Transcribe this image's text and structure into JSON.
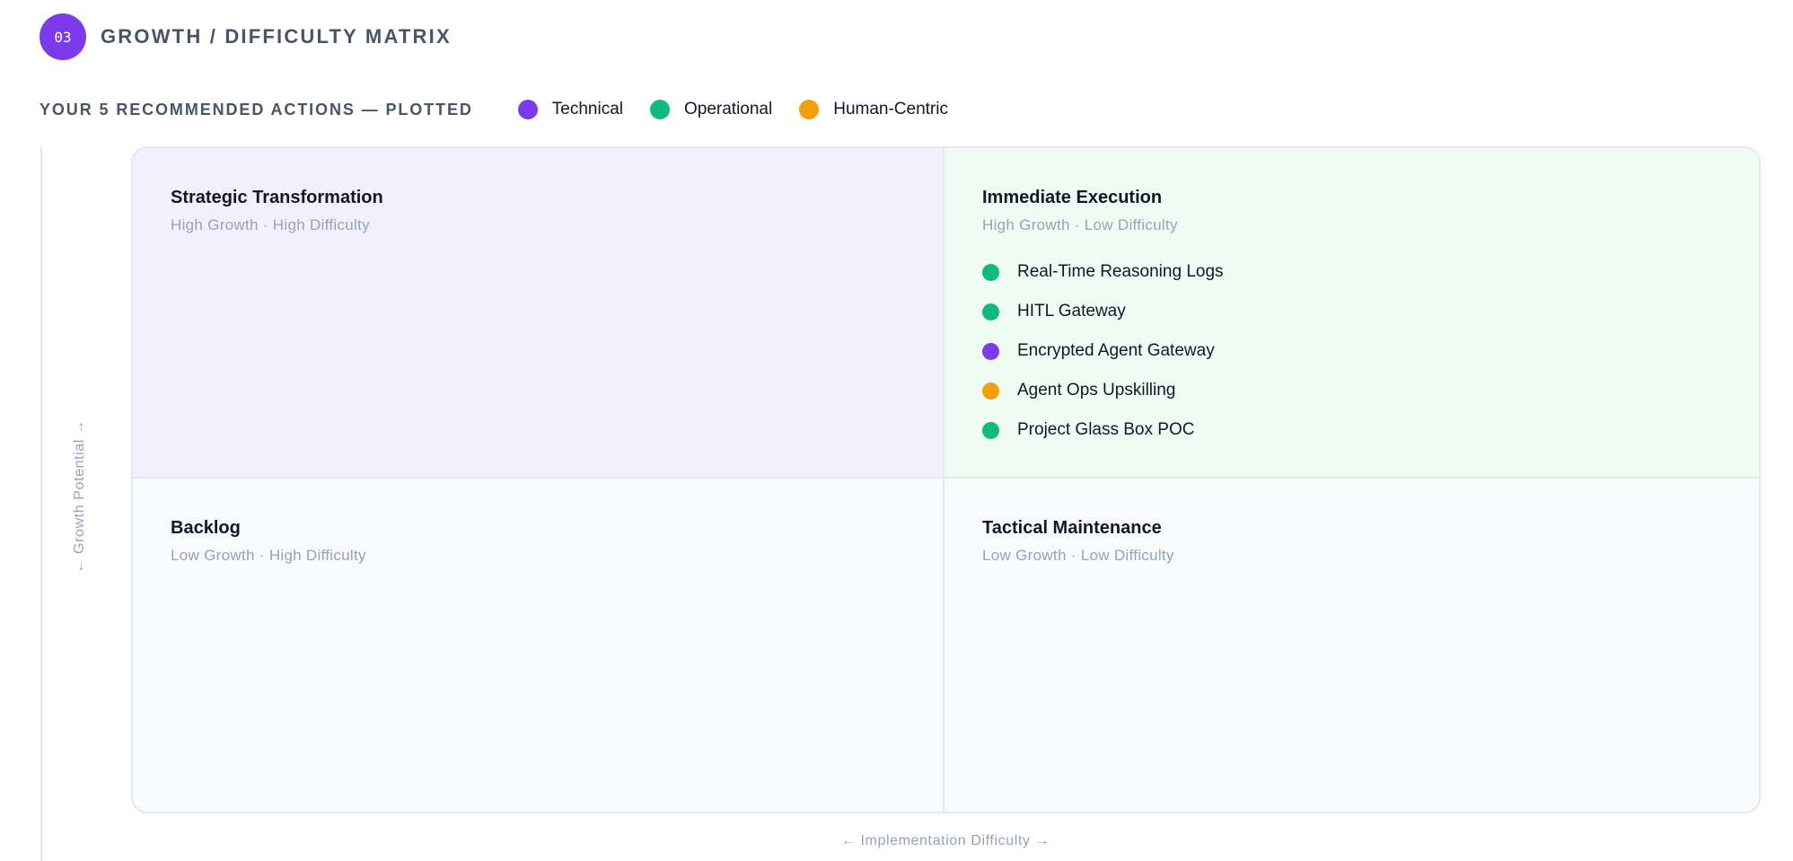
{
  "header": {
    "badge": "03",
    "title": "GROWTH / DIFFICULTY MATRIX"
  },
  "subheader": {
    "title": "YOUR 5 RECOMMENDED ACTIONS — PLOTTED"
  },
  "legend": [
    {
      "label": "Technical",
      "color": "#7c3aed"
    },
    {
      "label": "Operational",
      "color": "#10b981"
    },
    {
      "label": "Human-Centric",
      "color": "#f59e0b"
    }
  ],
  "axes": {
    "y_label": "← Growth Potential →",
    "x_label": "← Implementation Difficulty →"
  },
  "quadrants": {
    "top_left": {
      "title": "Strategic Transformation",
      "subtitle": "High Growth · High Difficulty",
      "items": []
    },
    "top_right": {
      "title": "Immediate Execution",
      "subtitle": "High Growth · Low Difficulty",
      "items": [
        {
          "label": "Real-Time Reasoning Logs",
          "category": "Operational",
          "color": "#10b981"
        },
        {
          "label": "HITL Gateway",
          "category": "Operational",
          "color": "#10b981"
        },
        {
          "label": "Encrypted Agent Gateway",
          "category": "Technical",
          "color": "#7c3aed"
        },
        {
          "label": "Agent Ops Upskilling",
          "category": "Human-Centric",
          "color": "#f59e0b"
        },
        {
          "label": "Project Glass Box POC",
          "category": "Operational",
          "color": "#10b981"
        }
      ]
    },
    "bottom_left": {
      "title": "Backlog",
      "subtitle": "Low Growth · High Difficulty",
      "items": []
    },
    "bottom_right": {
      "title": "Tactical Maintenance",
      "subtitle": "Low Growth · Low Difficulty",
      "items": []
    }
  }
}
